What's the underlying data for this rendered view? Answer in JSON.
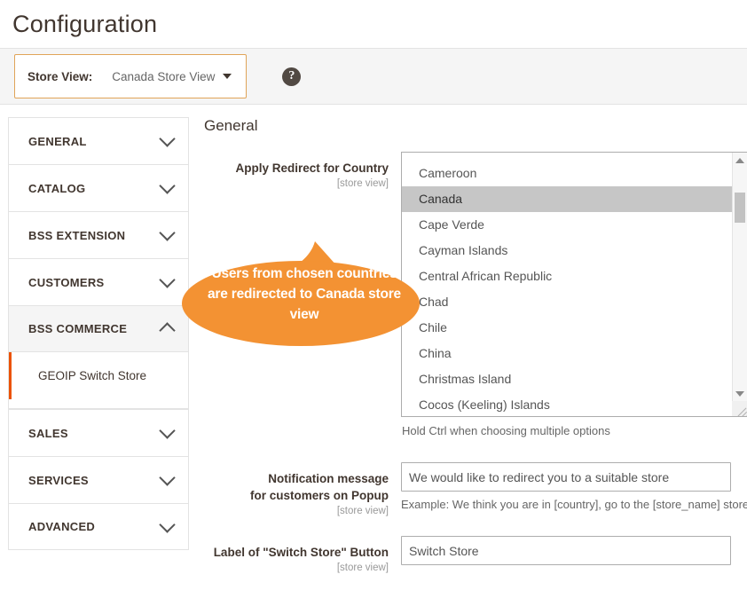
{
  "page": {
    "title": "Configuration"
  },
  "storeview": {
    "label": "Store View:",
    "value": "Canada Store View",
    "help_icon": "question-mark-icon",
    "caret_icon": "caret-down-icon"
  },
  "sidebar": {
    "sections": [
      {
        "title": "GENERAL",
        "state": "collapsed",
        "icon": "chevron-down-icon"
      },
      {
        "title": "CATALOG",
        "state": "collapsed",
        "icon": "chevron-down-icon"
      },
      {
        "title": "BSS EXTENSION",
        "state": "collapsed",
        "icon": "chevron-down-icon"
      },
      {
        "title": "CUSTOMERS",
        "state": "collapsed",
        "icon": "chevron-down-icon"
      },
      {
        "title": "BSS COMMERCE",
        "state": "expanded",
        "icon": "chevron-up-icon"
      }
    ],
    "subitems": [
      {
        "label": "GEOIP Switch Store",
        "active": true
      }
    ],
    "sections_after": [
      {
        "title": "SALES",
        "state": "collapsed",
        "icon": "chevron-down-icon"
      },
      {
        "title": "SERVICES",
        "state": "collapsed",
        "icon": "chevron-down-icon"
      },
      {
        "title": "ADVANCED",
        "state": "collapsed",
        "icon": "chevron-down-icon"
      }
    ]
  },
  "main": {
    "section_heading": "General",
    "fields": {
      "country": {
        "label": "Apply Redirect for Country",
        "scope": "[store view]",
        "options": [
          "Cameroon",
          "Canada",
          "Cape Verde",
          "Cayman Islands",
          "Central African Republic",
          "Chad",
          "Chile",
          "China",
          "Christmas Island",
          "Cocos (Keeling) Islands"
        ],
        "selected": "Canada",
        "note": "Hold Ctrl when choosing multiple options",
        "scroll_up_icon": "scroll-up-arrow-icon",
        "scroll_down_icon": "scroll-down-arrow-icon",
        "resize_icon": "resize-grip-icon"
      },
      "notification": {
        "label_line1": "Notification message",
        "label_line2": "for customers on Popup",
        "scope": "[store view]",
        "value": "We would like to redirect you to a suitable store ",
        "placeholder": "",
        "note": "Example: We think you are in [country], go to the [store_name] store"
      },
      "switch_button": {
        "label": "Label of \"Switch Store\" Button",
        "scope": "[store view]",
        "value": "Switch Store",
        "placeholder": ""
      }
    }
  },
  "callout": {
    "text": "Users from chosen countries are redirected to Canada store view",
    "color": "#f39233"
  }
}
